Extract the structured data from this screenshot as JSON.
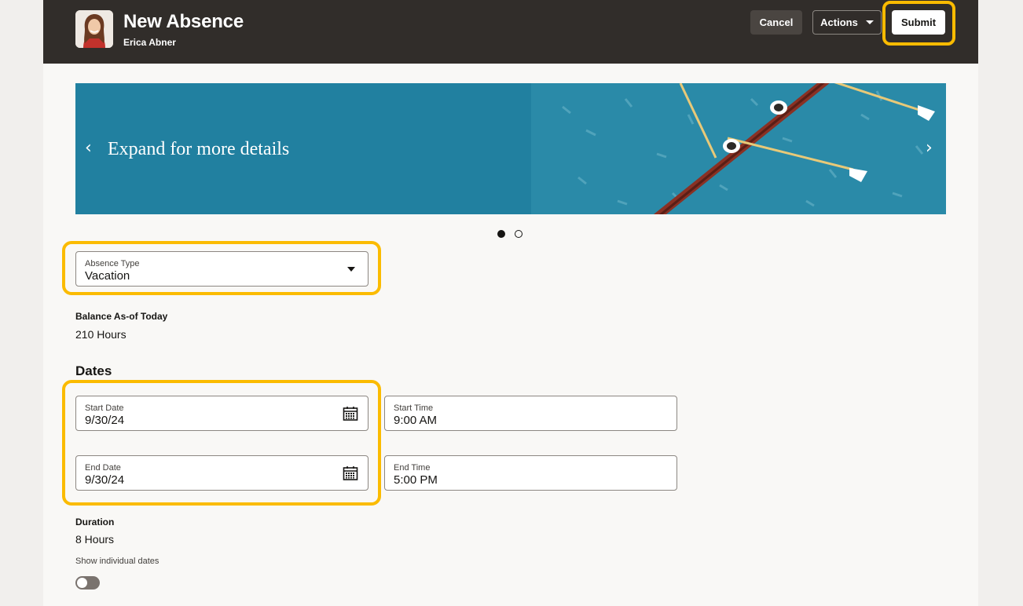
{
  "header": {
    "title": "New Absence",
    "user_name": "Erica Abner",
    "cancel_label": "Cancel",
    "actions_label": "Actions",
    "submit_label": "Submit"
  },
  "banner": {
    "text": "Expand for more details",
    "prev_icon": "chevron-left-icon",
    "next_icon": "chevron-right-icon",
    "page_count": 2,
    "active_page": 1
  },
  "absence_type": {
    "label": "Absence Type",
    "value": "Vacation"
  },
  "balance": {
    "label": "Balance As-of Today",
    "value": "210 Hours"
  },
  "dates": {
    "heading": "Dates",
    "start_date": {
      "label": "Start Date",
      "value": "9/30/24"
    },
    "start_time": {
      "label": "Start Time",
      "value": "9:00 AM"
    },
    "end_date": {
      "label": "End Date",
      "value": "9/30/24"
    },
    "end_time": {
      "label": "End Time",
      "value": "5:00 PM"
    }
  },
  "duration": {
    "label": "Duration",
    "value": "8 Hours"
  },
  "individual_dates": {
    "label": "Show individual dates",
    "enabled": false
  },
  "colors": {
    "header_bg": "#312d2a",
    "banner_bg": "#2180a0",
    "highlight": "#fbbb00"
  }
}
